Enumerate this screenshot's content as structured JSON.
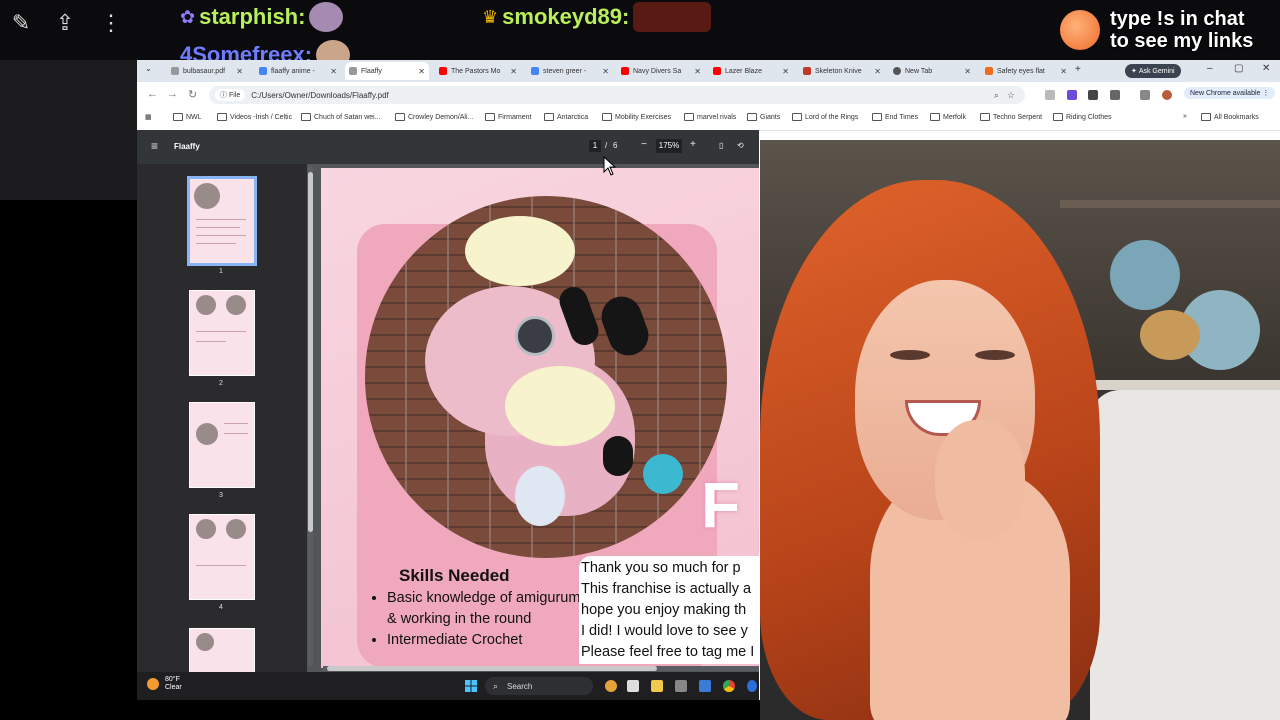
{
  "overlay": {
    "chat": [
      {
        "name": "starphish:",
        "color": "#b9f05a"
      },
      {
        "name": "smokeyd89:",
        "color": "#b9f05a"
      },
      {
        "name": "4Somefreex:",
        "color": "#6f7cff"
      }
    ],
    "cta_line1": "type !s in chat",
    "cta_line2": "to see my links"
  },
  "browser": {
    "tabs": [
      {
        "label": "bulbasaur.pdf",
        "color": "#999"
      },
      {
        "label": "flaaffy anime -",
        "color": "#4285f4"
      },
      {
        "label": "Flaaffy",
        "color": "#999"
      },
      {
        "label": "The Pastors Mo",
        "color": "#ff0000"
      },
      {
        "label": "steven greer -",
        "color": "#4285f4"
      },
      {
        "label": "Navy Divers Sa",
        "color": "#ff0000"
      },
      {
        "label": "Lazer Blaze",
        "color": "#ff0000"
      },
      {
        "label": "Skeleton Knive",
        "color": "#c0392b"
      },
      {
        "label": "New Tab",
        "color": "#555"
      },
      {
        "label": "Safety eyes flat",
        "color": "#f26b1d"
      }
    ],
    "ask_gemini": "Ask Gemini",
    "address": {
      "scheme": "File",
      "url": "C:/Users/Owner/Downloads/Flaaffy.pdf"
    },
    "new_chrome": "New Chrome available",
    "bookmarks": [
      "NWL",
      "Videos -Irish / Celtic",
      "Chuch of Satan wei...",
      "Crowley Demon/Ali...",
      "Firmament",
      "Antarctica",
      "Mobility Exercises",
      "marvel rivals",
      "Giants",
      "Lord of the Rings",
      "End Times",
      "Merfolk",
      "Techno Serpent",
      "Riding Clothes"
    ],
    "all_bookmarks": "All Bookmarks"
  },
  "pdf": {
    "title": "Flaaffy",
    "current_page": "1",
    "page_sep": "/",
    "total_pages": "6",
    "zoom": "175%",
    "thumbnails": [
      "1",
      "2",
      "3",
      "4"
    ],
    "skills_title": "Skills Needed",
    "skills": [
      "Basic knowledge of amigurumi & working in the round",
      "Intermediate Crochet"
    ],
    "thanks": [
      "Thank you so much for p",
      "This franchise is actually a",
      "hope you enjoy making th",
      "I did! I would love to see y",
      "Please feel free to tag me I"
    ],
    "big_letter": "F"
  },
  "taskbar": {
    "temp": "80°F",
    "condition": "Clear",
    "search": "Search"
  }
}
